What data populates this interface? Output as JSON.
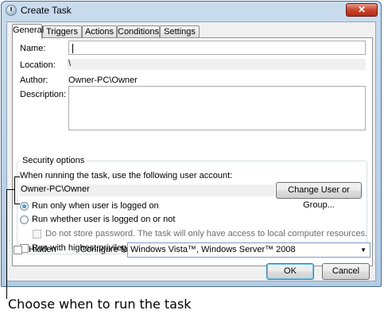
{
  "window": {
    "title": "Create Task",
    "close_glyph": "✕"
  },
  "tabs": [
    "General",
    "Triggers",
    "Actions",
    "Conditions",
    "Settings"
  ],
  "general": {
    "name_label": "Name:",
    "name_value": "",
    "location_label": "Location:",
    "location_value": "\\",
    "author_label": "Author:",
    "author_value": "Owner-PC\\Owner",
    "description_label": "Description:",
    "description_value": ""
  },
  "security": {
    "legend": "Security options",
    "account_prompt": "When running the task, use the following user account:",
    "account_value": "Owner-PC\\Owner",
    "change_button": "Change User or Group...",
    "run_logged_on": "Run only when user is logged on",
    "run_whether": "Run whether user is logged on or not",
    "no_store_password": "Do not store password.  The task will only have access to local computer resources.",
    "highest_privileges": "Run with highest privileges",
    "selected_option": "run_logged_on"
  },
  "bottom": {
    "hidden_label": "Hidden",
    "configure_label": "Configure for:",
    "configure_value": "Windows Vista™, Windows Server™ 2008"
  },
  "buttons": {
    "ok": "OK",
    "cancel": "Cancel"
  },
  "caption": "Choose when to run the task"
}
